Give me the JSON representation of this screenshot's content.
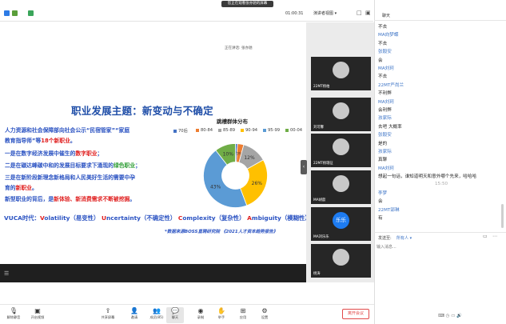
{
  "window": {
    "viewing_banner": "您正在观看张亦驰的屏幕",
    "timer": "01:00:31",
    "view_toggle": "演讲者视图 ▾",
    "controls": [
      "□",
      "▣",
      "—",
      "□",
      "✕"
    ]
  },
  "stage": {
    "presenter_label": "正在讲话: 张亦驰"
  },
  "slide": {
    "title": "职业发展主题：新变动与不确定",
    "para1_a": "人力资源和社会保障部向社会公示“民宿管家”“家庭",
    "para1_b": "教育指导师”等",
    "para1_c": "18个新职业",
    "para1_d": "。",
    "para2_a": "一是在数字经济发展中催生的",
    "para2_b": "数字职业",
    "para2_c": "；",
    "para3_a": "二是在碳达峰碳中和的发展目标要求下涌现的",
    "para3_b": "绿色职业",
    "para3_c": "；",
    "para4_a": "三是在新阶段新理念新格局和人民美好生活的需要中孕",
    "para4_b": "育的",
    "para4_c": "新职业",
    "para4_d": "。",
    "para5_a": "新型职业的背后，是",
    "para5_b": "新体验、新消费需求不断被挖掘",
    "para5_c": "。",
    "vuca_label": "VUCA时代：",
    "vuca_v": "V",
    "vuca_v_rest": "olatility（易变性）",
    "vuca_u": "U",
    "vuca_u_rest": "ncertainty（不确定性）",
    "vuca_c": "C",
    "vuca_c_rest": "omplexity（复杂性）",
    "vuca_a": "A",
    "vuca_a_rest": "mbiguity（模糊性）",
    "source": "*数据来源BOSS直聘研究院 《2021人才资本趋势报告》"
  },
  "chart_data": {
    "type": "pie",
    "title": "跳槽群体分布",
    "categories": [
      "70后",
      "80-84",
      "85-89",
      "90-94",
      "95-99",
      "00-04"
    ],
    "colors": [
      "#4472c4",
      "#ed7d31",
      "#a5a5a5",
      "#ffc000",
      "#5b9bd5",
      "#70ad47"
    ],
    "values": [
      1,
      3,
      12,
      26,
      43,
      10
    ],
    "data_labels": [
      "1%",
      "3%",
      "12%",
      "26%",
      "43%",
      "10%"
    ],
    "legend_placement": "top",
    "donut": true
  },
  "participants": [
    {
      "name": "22MT杨柏",
      "avatar": "photo"
    },
    {
      "name": "刘可馨",
      "avatar": "photo"
    },
    {
      "name": "22MT杨瑞征",
      "avatar": "photo"
    },
    {
      "name": "MA胡歆",
      "avatar": "photo"
    },
    {
      "name": "MA刘乐乐",
      "avatar": "乐乐"
    },
    {
      "name": "杨涛",
      "avatar": "photo"
    }
  ],
  "chat": {
    "title": "聊天",
    "messages": [
      {
        "kind": "text",
        "value": "不去"
      },
      {
        "kind": "user",
        "value": "MA向梦蝶"
      },
      {
        "kind": "text",
        "value": "不去"
      },
      {
        "kind": "user",
        "value": "张毅安"
      },
      {
        "kind": "text",
        "value": "会"
      },
      {
        "kind": "user",
        "value": "MA刘珂"
      },
      {
        "kind": "text",
        "value": "不去"
      },
      {
        "kind": "user",
        "value": "22MT严尚兰"
      },
      {
        "kind": "text",
        "value": "不利弊"
      },
      {
        "kind": "user",
        "value": "MA刘珂"
      },
      {
        "kind": "text",
        "value": "会利弊"
      },
      {
        "kind": "user",
        "value": "孩家际"
      },
      {
        "kind": "text",
        "value": "去吧 大概率"
      },
      {
        "kind": "user",
        "value": "张毅安"
      },
      {
        "kind": "text",
        "value": "是的"
      },
      {
        "kind": "user",
        "value": "孩家际"
      },
      {
        "kind": "text",
        "value": "真聊"
      },
      {
        "kind": "user",
        "value": "MA刘珂"
      },
      {
        "kind": "text",
        "value": "想起一句话，谁知道明天和意外哪个先来，哈哈哈"
      },
      {
        "kind": "time",
        "value": "15:50"
      },
      {
        "kind": "user",
        "value": "李梦"
      },
      {
        "kind": "text",
        "value": "会"
      },
      {
        "kind": "user",
        "value": "22MT邵琳"
      },
      {
        "kind": "text",
        "value": "有"
      }
    ],
    "send_label": "发送至:",
    "send_target": "所有人 ▾",
    "input_placeholder": "输入消息..."
  },
  "toolbar": {
    "items": [
      {
        "id": "mute",
        "label": "解除静音",
        "icon": "mic-icon"
      },
      {
        "id": "video",
        "label": "开启视频",
        "icon": "camera-icon"
      },
      {
        "id": "share",
        "label": "共享屏幕",
        "icon": "share-screen-icon"
      },
      {
        "id": "invite",
        "label": "邀请",
        "icon": "invite-icon"
      },
      {
        "id": "members",
        "label": "成员(85)",
        "icon": "members-icon"
      },
      {
        "id": "chat",
        "label": "聊天",
        "icon": "chat-icon"
      },
      {
        "id": "record",
        "label": "录制",
        "icon": "record-icon"
      },
      {
        "id": "raise-hand",
        "label": "举手",
        "icon": "hand-icon"
      },
      {
        "id": "apps",
        "label": "应用",
        "icon": "apps-icon"
      },
      {
        "id": "settings",
        "label": "设置",
        "icon": "gear-icon"
      }
    ],
    "leave_label": "离开会议"
  }
}
